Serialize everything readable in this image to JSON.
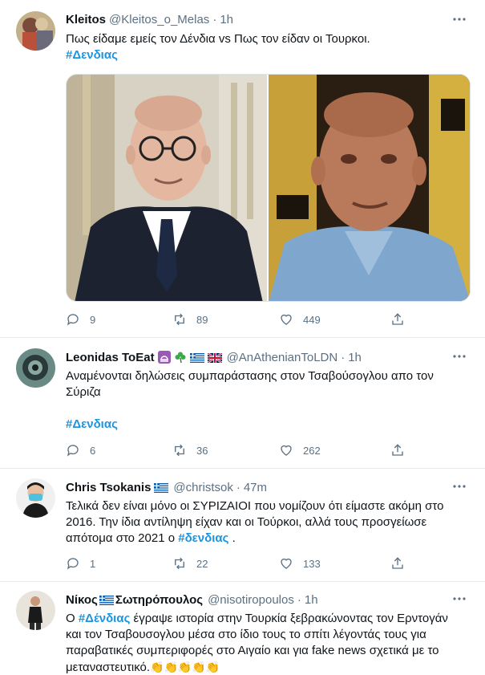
{
  "colors": {
    "link": "#1b95e0",
    "muted": "#5b7083",
    "divider": "#e6ecf0"
  },
  "tweets": [
    {
      "name": "Kleitos",
      "handle": "@Kleitos_o_Melas",
      "time": "1h",
      "text_before": "Πως είδαμε εμείς τον Δένδια vs Πως τον είδαν οι Τουρκοι.",
      "hashtag": "#Δενδιας",
      "replies": "9",
      "retweets": "89",
      "likes": "449"
    },
    {
      "name": "Leonidas ToEat",
      "handle": "@AnAthenianToLDN",
      "time": "1h",
      "text": "Αναμένονται δηλώσεις συμπαράστασης στον Τσαβούσογλου απο τον Σύριζα",
      "hashtag": "#Δενδιας",
      "replies": "6",
      "retweets": "36",
      "likes": "262"
    },
    {
      "name": "Chris Tsokanis",
      "handle": "@christsok",
      "time": "47m",
      "text_line1": "Τελικά δεν είναι μόνο οι ΣΥΡΙΖΑΙΟΙ που νομίζουν ότι είμαστε ακόμη στο",
      "text_line2": "2016. Την ίδια αντίληψη είχαν και οι Τούρκοι, αλλά τους προσγείωσε",
      "text_line3_before": "απότομα στο 2021 ο",
      "hashtag": "#δενδιας",
      "text_line3_after": ".",
      "replies": "1",
      "retweets": "22",
      "likes": "133"
    },
    {
      "name_part1": "Νίκος",
      "name_part2": "Σωτηρόπουλος",
      "handle": "@nisotiropoulos",
      "time": "1h",
      "text_line1_before": "Ο",
      "hashtag": "#Δένδιας",
      "text_line1_after": "έγραψε ιστορία στην Τουρκία ξεβρακώνοντας τον Ερντογάν",
      "text_line2": "και τον Τσαβουσογλου μέσα στο ίδιο τους το σπίτι λέγοντάς τους για",
      "text_line3": "παραβατικές συμπεριφορές στο Αιγαίο και για fake news σχετικά με το",
      "text_line4": "μεταναστευτικό.",
      "clap_emoji": "👏👏👏👏👏"
    }
  ],
  "separator": "·"
}
